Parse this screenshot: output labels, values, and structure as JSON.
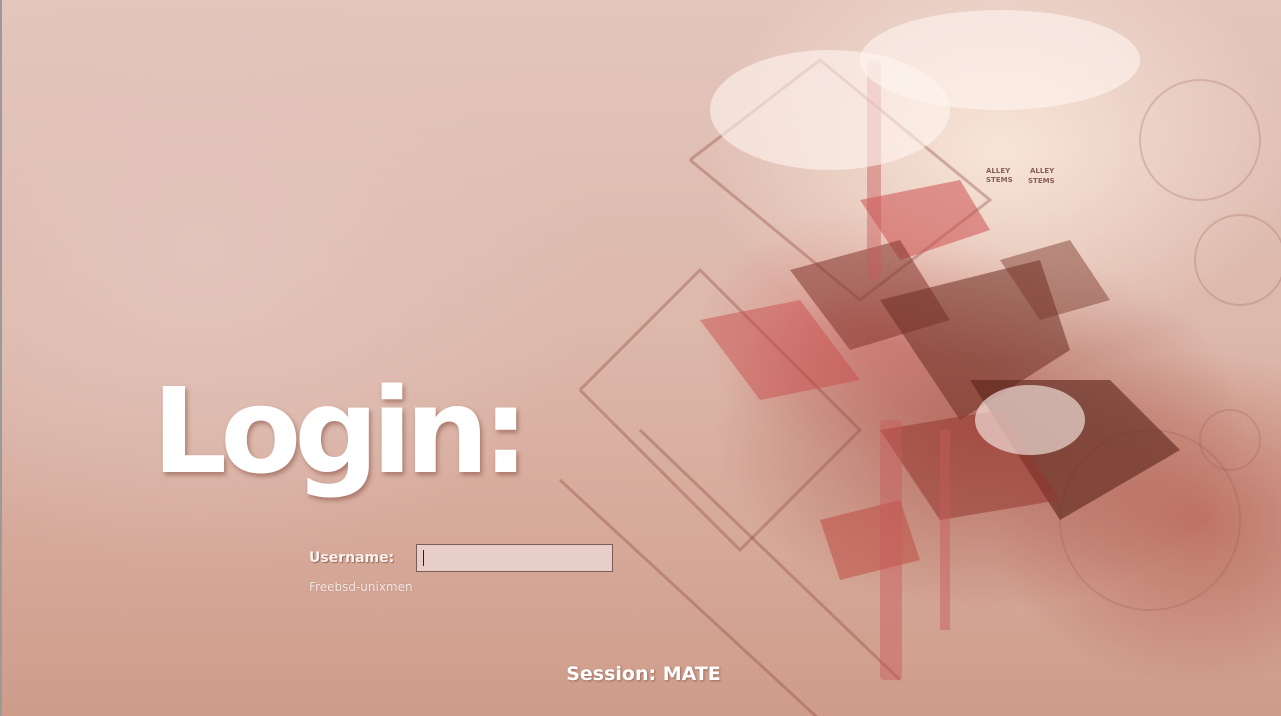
{
  "login_screen": {
    "title": "Login:",
    "username_label": "Username:",
    "username_value": "",
    "hostname": "Freebsd-unixmen",
    "session_label": "Session: MATE"
  },
  "wallpaper": {
    "description_colors": {
      "base": "#e3c1b6",
      "highlight": "#fcecde",
      "accent_red": "#c84a48",
      "dark_brown": "#6e2c22"
    },
    "overlay_text": [
      "ALLEY",
      "ALLEY",
      "STEMS",
      "STEMS"
    ]
  }
}
